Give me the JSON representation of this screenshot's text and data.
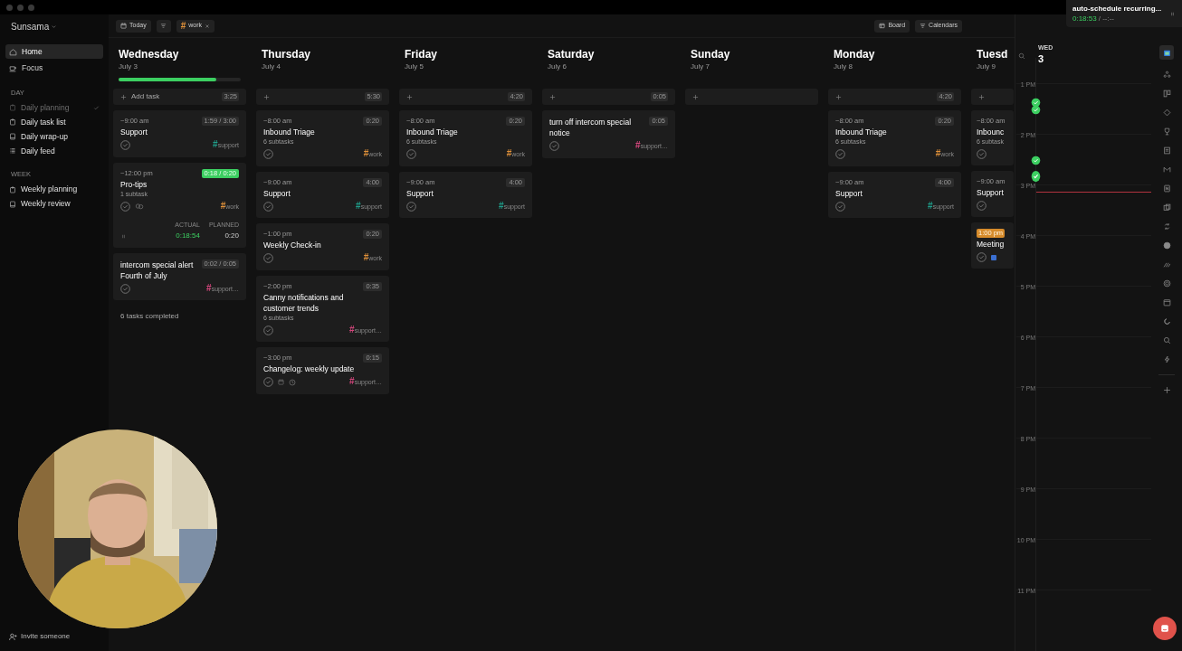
{
  "window": {
    "app": "Sunsama"
  },
  "sidebar": {
    "items": [
      {
        "label": "Home",
        "selected": true
      },
      {
        "label": "Focus",
        "selected": false
      }
    ],
    "sections": [
      {
        "heading": "DAY",
        "items": [
          {
            "label": "Daily planning",
            "done": true
          },
          {
            "label": "Daily task list",
            "done": false
          },
          {
            "label": "Daily wrap-up",
            "done": false
          },
          {
            "label": "Daily feed",
            "done": false
          }
        ]
      },
      {
        "heading": "WEEK",
        "items": [
          {
            "label": "Weekly planning",
            "done": false
          },
          {
            "label": "Weekly review",
            "done": false
          }
        ]
      }
    ],
    "invite": "Invite someone"
  },
  "toolbar": {
    "today": "Today",
    "tag_filter": {
      "hash": "#",
      "name": "work",
      "color": "#e0913a"
    },
    "board": "Board",
    "calendars": "Calendars"
  },
  "days": [
    {
      "day": "Wednesday",
      "date": "July 3",
      "level": 0.8,
      "add_label": "Add task",
      "total": "3:25",
      "completed": "6 tasks completed",
      "tasks": [
        {
          "kind": "task",
          "time": "~9:00 am",
          "title": "Support",
          "duration": "1:59 / 3:00",
          "active": false,
          "tag": {
            "hash": "#",
            "name": "support",
            "color": "#1f9e8a"
          }
        },
        {
          "kind": "task",
          "time": "~12:00 pm",
          "title": "Pro-tips",
          "subtasks": "1 subtask",
          "duration": "0:18 / 0:20",
          "active": true,
          "tag": {
            "hash": "#",
            "name": "work",
            "color": "#e0913a"
          },
          "linked": true,
          "timer": {
            "actual_label": "ACTUAL",
            "actual": "0:18:54",
            "planned_label": "PLANNED",
            "planned": "0:20"
          }
        },
        {
          "kind": "task",
          "title": "intercom special alert Fourth of July",
          "duration": "0:02 / 0:05",
          "active": false,
          "tag": {
            "hash": "#",
            "name": "support…",
            "color": "#d0457a"
          }
        }
      ]
    },
    {
      "day": "Thursday",
      "date": "July 4",
      "total": "5:30",
      "tasks": [
        {
          "kind": "task",
          "time": "~8:00 am",
          "title": "Inbound Triage",
          "subtasks": "6 subtasks",
          "duration": "0:20",
          "active": false,
          "tag": {
            "hash": "#",
            "name": "work",
            "color": "#e0913a"
          }
        },
        {
          "kind": "task",
          "time": "~9:00 am",
          "title": "Support",
          "duration": "4:00",
          "active": false,
          "tag": {
            "hash": "#",
            "name": "support",
            "color": "#1f9e8a"
          }
        },
        {
          "kind": "task",
          "time": "~1:00 pm",
          "title": "Weekly Check-in",
          "duration": "0:20",
          "active": false,
          "tag": {
            "hash": "#",
            "name": "work",
            "color": "#e0913a"
          }
        },
        {
          "kind": "task",
          "time": "~2:00 pm",
          "title": "Canny notifications and customer trends",
          "subtasks": "6 subtasks",
          "duration": "0:35",
          "active": false,
          "tag": {
            "hash": "#",
            "name": "support…",
            "color": "#d0457a"
          }
        },
        {
          "kind": "task",
          "time": "~3:00 pm",
          "title": "Changelog: weekly update",
          "duration": "0:15",
          "active": false,
          "scheduled": true,
          "tag": {
            "hash": "#",
            "name": "support…",
            "color": "#d0457a"
          }
        }
      ]
    },
    {
      "day": "Friday",
      "date": "July 5",
      "total": "4:20",
      "tasks": [
        {
          "kind": "task",
          "time": "~8:00 am",
          "title": "Inbound Triage",
          "subtasks": "6 subtasks",
          "duration": "0:20",
          "active": false,
          "tag": {
            "hash": "#",
            "name": "work",
            "color": "#e0913a"
          }
        },
        {
          "kind": "task",
          "time": "~9:00 am",
          "title": "Support",
          "duration": "4:00",
          "active": false,
          "tag": {
            "hash": "#",
            "name": "support",
            "color": "#1f9e8a"
          }
        }
      ]
    },
    {
      "day": "Saturday",
      "date": "July 6",
      "total": "0:05",
      "tasks": [
        {
          "kind": "task",
          "title": "turn off intercom special notice",
          "duration": "0:05",
          "active": false,
          "tag": {
            "hash": "#",
            "name": "support…",
            "color": "#d0457a"
          }
        }
      ]
    },
    {
      "day": "Sunday",
      "date": "July 7"
    },
    {
      "day": "Monday",
      "date": "July 8",
      "total": "4:20",
      "tasks": [
        {
          "kind": "task",
          "time": "~8:00 am",
          "title": "Inbound Triage",
          "subtasks": "6 subtasks",
          "duration": "0:20",
          "active": false,
          "tag": {
            "hash": "#",
            "name": "work",
            "color": "#e0913a"
          }
        },
        {
          "kind": "task",
          "time": "~9:00 am",
          "title": "Support",
          "duration": "4:00",
          "active": false,
          "tag": {
            "hash": "#",
            "name": "support",
            "color": "#1f9e8a"
          }
        }
      ]
    },
    {
      "day": "Tuesd",
      "date": "July 9",
      "tasks": [
        {
          "kind": "task",
          "time": "~8:00 am",
          "title": "Inbounc",
          "subtasks": "6 subtask"
        },
        {
          "kind": "task",
          "time": "~9:00 am",
          "title": "Support"
        },
        {
          "kind": "event",
          "time": "1:00 pm",
          "title": "Meeting"
        }
      ]
    }
  ],
  "calendar": {
    "weekday": "WED",
    "date": "3",
    "hours": [
      "1 PM",
      "2 PM",
      "3 PM",
      "4 PM",
      "5 PM",
      "6 PM",
      "7 PM",
      "8 PM",
      "9 PM",
      "10 PM",
      "11 PM"
    ]
  },
  "timer_popup": {
    "title": "auto-schedule recurring...",
    "elapsed": "0:18:53",
    "planned": "/ --:--"
  }
}
